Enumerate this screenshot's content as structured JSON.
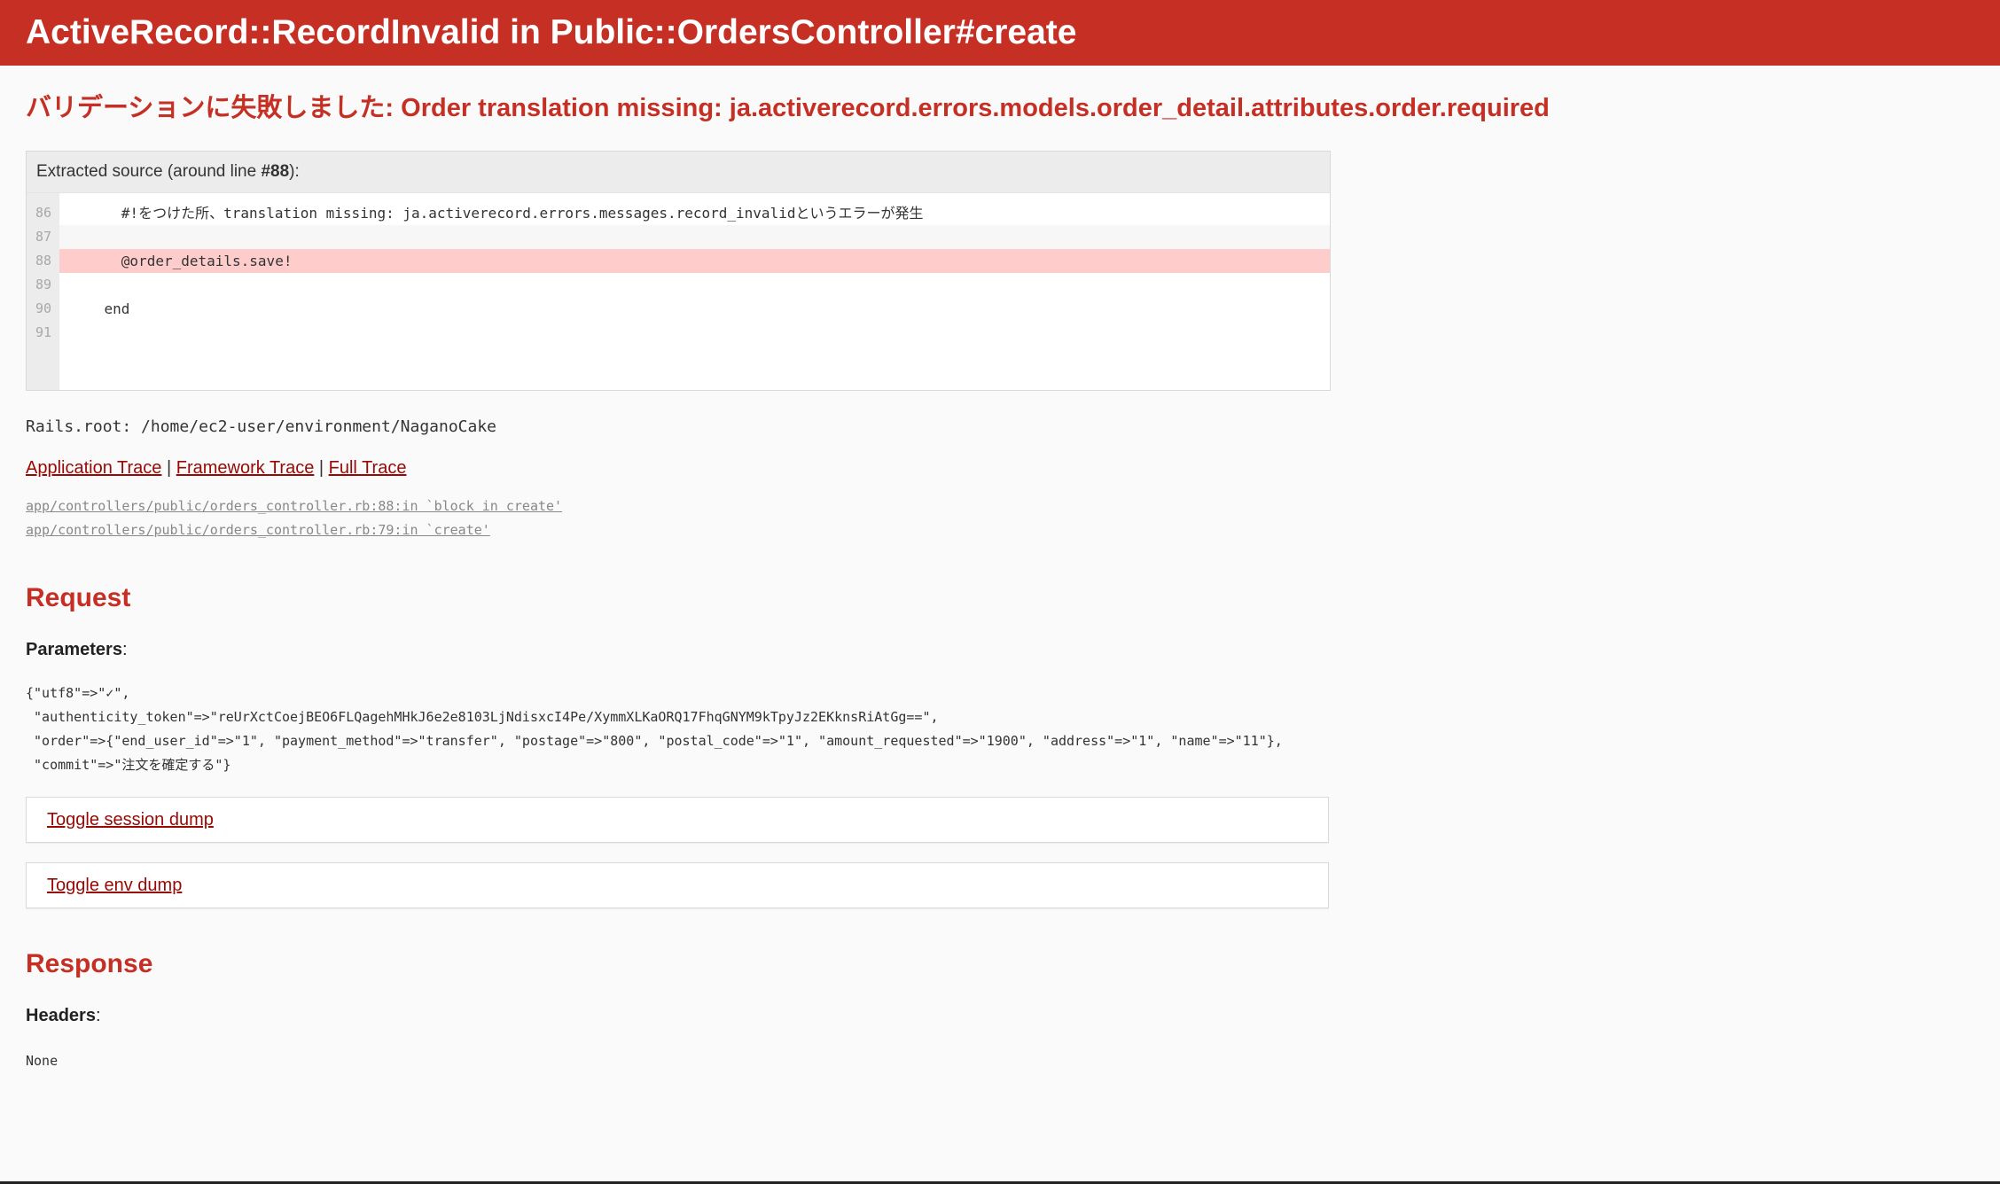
{
  "header": {
    "title": "ActiveRecord::RecordInvalid in Public::OrdersController#create"
  },
  "exception": {
    "message": "バリデーションに失敗しました: Order translation missing: ja.activerecord.errors.models.order_detail.attributes.order.required"
  },
  "source": {
    "info_prefix": "Extracted source (around line ",
    "info_line": "#88",
    "info_suffix": "):",
    "line_numbers": [
      "86",
      "87",
      "88",
      "89",
      "90",
      "91"
    ],
    "lines": [
      "      #!をつけた所、translation missing: ja.activerecord.errors.messages.record_invalidというエラーが発生",
      "",
      "      @order_details.save!",
      "",
      "    end",
      ""
    ],
    "highlighted_line": "88"
  },
  "rails_root": "Rails.root: /home/ec2-user/environment/NaganoCake",
  "trace_links": {
    "application": "Application Trace",
    "separator": " | ",
    "framework": "Framework Trace",
    "full": "Full Trace"
  },
  "trace": [
    "app/controllers/public/orders_controller.rb:88:in `block in create'",
    "app/controllers/public/orders_controller.rb:79:in `create'"
  ],
  "request": {
    "heading": "Request",
    "params_label": "Parameters",
    "params_lines": [
      "{\"utf8\"=>\"✓\",",
      " \"authenticity_token\"=>\"reUrXctCoejBEO6FLQagehMHkJ6e2e8103LjNdisxcI4Pe/XymmXLKaORQ17FhqGNYM9kTpyJz2EKknsRiAtGg==\",",
      " \"order\"=>{\"end_user_id\"=>\"1\", \"payment_method\"=>\"transfer\", \"postage\"=>\"800\", \"postal_code\"=>\"1\", \"amount_requested\"=>\"1900\", \"address\"=>\"1\", \"name\"=>\"11\"},",
      " \"commit\"=>\"注文を確定する\"}"
    ],
    "toggle_session": "Toggle session dump",
    "toggle_env": "Toggle env dump"
  },
  "response": {
    "heading": "Response",
    "headers_label": "Headers",
    "headers_value": "None"
  },
  "colors": {
    "header_bg": "#c52f24",
    "link": "#980905",
    "highlight": "#ffcccc"
  }
}
